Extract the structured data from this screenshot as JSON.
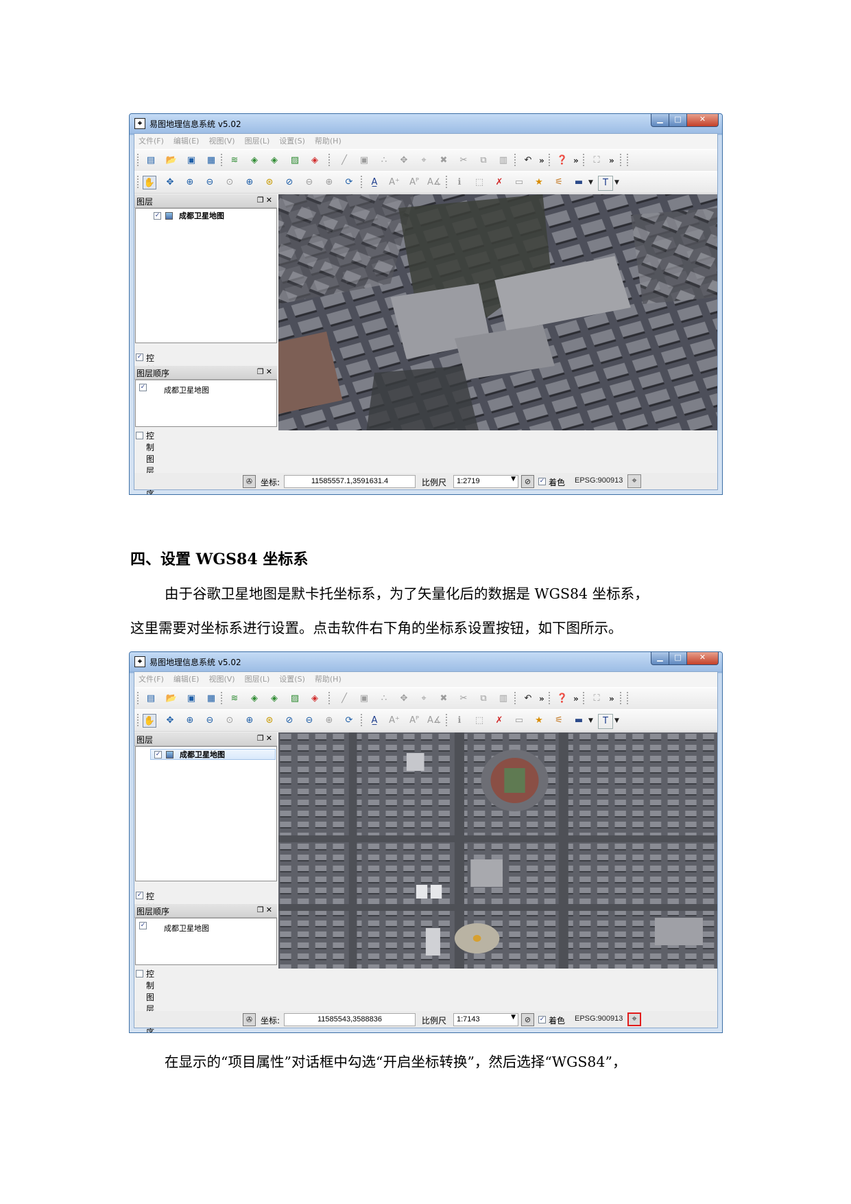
{
  "heading": "四、设置 WGS84 坐标系",
  "paragraph_1": "由于谷歌卫星地图是默卡托坐标系，为了矢量化后的数据是 WGS84 坐标系，",
  "paragraph_2": "这里需要对坐标系进行设置。点击软件右下角的坐标系设置按钮，如下图所示。",
  "paragraph_3": "在显示的“项目属性”对话框中勾选“开启坐标转换”，然后选择“WGS84”，",
  "screenshots": [
    {
      "window_title": "易图地理信息系统 v5.02",
      "menu": [
        "文件(F)",
        "编辑(E)",
        "视图(V)",
        "图层(L)",
        "设置(S)",
        "帮助(H)"
      ],
      "layers_panel_title": "图层",
      "layer_name": "成都卫星地图",
      "control_layers_label": "控制图层",
      "layer_order_panel_title": "图层顺序",
      "order_layer_name": "成都卫星地图",
      "control_layer_order_label": "控制图层顺序",
      "coord_label": "坐标:",
      "coord_value": "11585557.1,3591631.4",
      "scale_label": "比例尺",
      "scale_value": "1:2719",
      "render_label": "着色",
      "epsg": "EPSG:900913",
      "crs_button_highlighted": false,
      "map_view": "oblique close-up satellite image of buildings"
    },
    {
      "window_title": "易图地理信息系统 v5.02",
      "menu": [
        "文件(F)",
        "编辑(E)",
        "视图(V)",
        "图层(L)",
        "设置(S)",
        "帮助(H)"
      ],
      "layers_panel_title": "图层",
      "layer_name": "成都卫星地图",
      "control_layers_label": "控制图层",
      "layer_order_panel_title": "图层顺序",
      "order_layer_name": "成都卫星地图",
      "control_layer_order_label": "控制图层顺序",
      "coord_label": "坐标:",
      "coord_value": "11585543,3588836",
      "scale_label": "比例尺",
      "scale_value": "1:7143",
      "render_label": "着色",
      "epsg": "EPSG:900913",
      "crs_button_highlighted": true,
      "map_view": "overhead satellite image of city blocks with a stadium"
    }
  ],
  "colors": {
    "highlight_border": "#e21b1b",
    "window_frame": "#9dbde5"
  }
}
